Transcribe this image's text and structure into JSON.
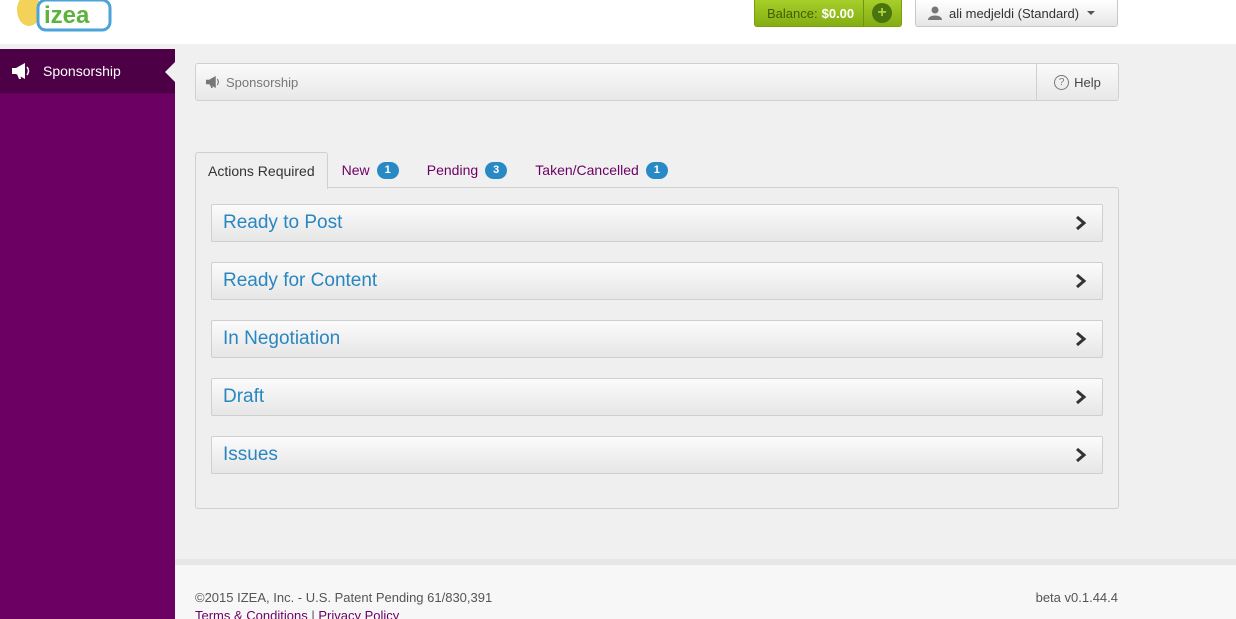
{
  "header": {
    "logo_text": "izea",
    "balance_label": "Balance:",
    "balance_amount": "$0.00",
    "user_label": "ali medjeldi (Standard)"
  },
  "sidebar": {
    "items": [
      {
        "label": "Sponsorship",
        "icon": "megaphone-icon"
      }
    ]
  },
  "breadcrumb": {
    "title": "Sponsorship",
    "help_label": "Help"
  },
  "tabs": [
    {
      "label": "Actions Required",
      "badge": null,
      "active": true
    },
    {
      "label": "New",
      "badge": "1"
    },
    {
      "label": "Pending",
      "badge": "3"
    },
    {
      "label": "Taken/Cancelled",
      "badge": "1"
    }
  ],
  "sections": [
    {
      "label": "Ready to Post"
    },
    {
      "label": "Ready for Content"
    },
    {
      "label": "In Negotiation"
    },
    {
      "label": "Draft"
    },
    {
      "label": "Issues"
    }
  ],
  "footer": {
    "copyright": "©2015 IZEA, Inc. - U.S. Patent Pending 61/830,391",
    "terms": "Terms & Conditions",
    "separator": "|",
    "privacy": "Privacy Policy",
    "version": "beta v0.1.44.4"
  },
  "colors": {
    "brand_purple": "#6d0063",
    "link_blue": "#2a86c0",
    "balance_green": "#a6cf2a",
    "badge_blue": "#2889c4"
  }
}
